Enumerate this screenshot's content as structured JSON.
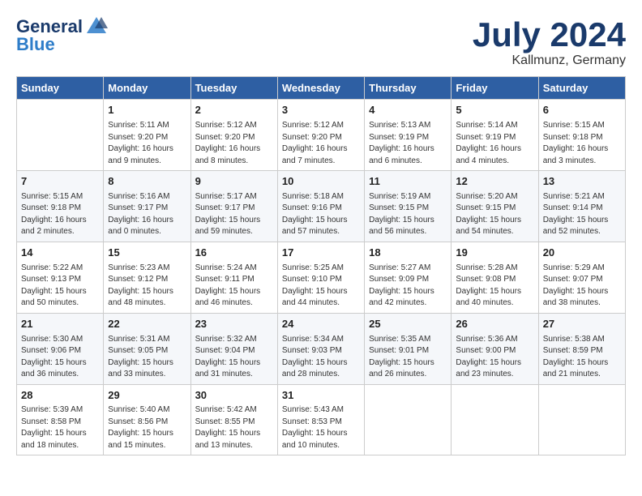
{
  "header": {
    "logo_general": "General",
    "logo_blue": "Blue",
    "month_title": "July 2024",
    "location": "Kallmunz, Germany"
  },
  "days_of_week": [
    "Sunday",
    "Monday",
    "Tuesday",
    "Wednesday",
    "Thursday",
    "Friday",
    "Saturday"
  ],
  "weeks": [
    [
      {
        "day": "",
        "info": ""
      },
      {
        "day": "1",
        "info": "Sunrise: 5:11 AM\nSunset: 9:20 PM\nDaylight: 16 hours\nand 9 minutes."
      },
      {
        "day": "2",
        "info": "Sunrise: 5:12 AM\nSunset: 9:20 PM\nDaylight: 16 hours\nand 8 minutes."
      },
      {
        "day": "3",
        "info": "Sunrise: 5:12 AM\nSunset: 9:20 PM\nDaylight: 16 hours\nand 7 minutes."
      },
      {
        "day": "4",
        "info": "Sunrise: 5:13 AM\nSunset: 9:19 PM\nDaylight: 16 hours\nand 6 minutes."
      },
      {
        "day": "5",
        "info": "Sunrise: 5:14 AM\nSunset: 9:19 PM\nDaylight: 16 hours\nand 4 minutes."
      },
      {
        "day": "6",
        "info": "Sunrise: 5:15 AM\nSunset: 9:18 PM\nDaylight: 16 hours\nand 3 minutes."
      }
    ],
    [
      {
        "day": "7",
        "info": "Sunrise: 5:15 AM\nSunset: 9:18 PM\nDaylight: 16 hours\nand 2 minutes."
      },
      {
        "day": "8",
        "info": "Sunrise: 5:16 AM\nSunset: 9:17 PM\nDaylight: 16 hours\nand 0 minutes."
      },
      {
        "day": "9",
        "info": "Sunrise: 5:17 AM\nSunset: 9:17 PM\nDaylight: 15 hours\nand 59 minutes."
      },
      {
        "day": "10",
        "info": "Sunrise: 5:18 AM\nSunset: 9:16 PM\nDaylight: 15 hours\nand 57 minutes."
      },
      {
        "day": "11",
        "info": "Sunrise: 5:19 AM\nSunset: 9:15 PM\nDaylight: 15 hours\nand 56 minutes."
      },
      {
        "day": "12",
        "info": "Sunrise: 5:20 AM\nSunset: 9:15 PM\nDaylight: 15 hours\nand 54 minutes."
      },
      {
        "day": "13",
        "info": "Sunrise: 5:21 AM\nSunset: 9:14 PM\nDaylight: 15 hours\nand 52 minutes."
      }
    ],
    [
      {
        "day": "14",
        "info": "Sunrise: 5:22 AM\nSunset: 9:13 PM\nDaylight: 15 hours\nand 50 minutes."
      },
      {
        "day": "15",
        "info": "Sunrise: 5:23 AM\nSunset: 9:12 PM\nDaylight: 15 hours\nand 48 minutes."
      },
      {
        "day": "16",
        "info": "Sunrise: 5:24 AM\nSunset: 9:11 PM\nDaylight: 15 hours\nand 46 minutes."
      },
      {
        "day": "17",
        "info": "Sunrise: 5:25 AM\nSunset: 9:10 PM\nDaylight: 15 hours\nand 44 minutes."
      },
      {
        "day": "18",
        "info": "Sunrise: 5:27 AM\nSunset: 9:09 PM\nDaylight: 15 hours\nand 42 minutes."
      },
      {
        "day": "19",
        "info": "Sunrise: 5:28 AM\nSunset: 9:08 PM\nDaylight: 15 hours\nand 40 minutes."
      },
      {
        "day": "20",
        "info": "Sunrise: 5:29 AM\nSunset: 9:07 PM\nDaylight: 15 hours\nand 38 minutes."
      }
    ],
    [
      {
        "day": "21",
        "info": "Sunrise: 5:30 AM\nSunset: 9:06 PM\nDaylight: 15 hours\nand 36 minutes."
      },
      {
        "day": "22",
        "info": "Sunrise: 5:31 AM\nSunset: 9:05 PM\nDaylight: 15 hours\nand 33 minutes."
      },
      {
        "day": "23",
        "info": "Sunrise: 5:32 AM\nSunset: 9:04 PM\nDaylight: 15 hours\nand 31 minutes."
      },
      {
        "day": "24",
        "info": "Sunrise: 5:34 AM\nSunset: 9:03 PM\nDaylight: 15 hours\nand 28 minutes."
      },
      {
        "day": "25",
        "info": "Sunrise: 5:35 AM\nSunset: 9:01 PM\nDaylight: 15 hours\nand 26 minutes."
      },
      {
        "day": "26",
        "info": "Sunrise: 5:36 AM\nSunset: 9:00 PM\nDaylight: 15 hours\nand 23 minutes."
      },
      {
        "day": "27",
        "info": "Sunrise: 5:38 AM\nSunset: 8:59 PM\nDaylight: 15 hours\nand 21 minutes."
      }
    ],
    [
      {
        "day": "28",
        "info": "Sunrise: 5:39 AM\nSunset: 8:58 PM\nDaylight: 15 hours\nand 18 minutes."
      },
      {
        "day": "29",
        "info": "Sunrise: 5:40 AM\nSunset: 8:56 PM\nDaylight: 15 hours\nand 15 minutes."
      },
      {
        "day": "30",
        "info": "Sunrise: 5:42 AM\nSunset: 8:55 PM\nDaylight: 15 hours\nand 13 minutes."
      },
      {
        "day": "31",
        "info": "Sunrise: 5:43 AM\nSunset: 8:53 PM\nDaylight: 15 hours\nand 10 minutes."
      },
      {
        "day": "",
        "info": ""
      },
      {
        "day": "",
        "info": ""
      },
      {
        "day": "",
        "info": ""
      }
    ]
  ]
}
